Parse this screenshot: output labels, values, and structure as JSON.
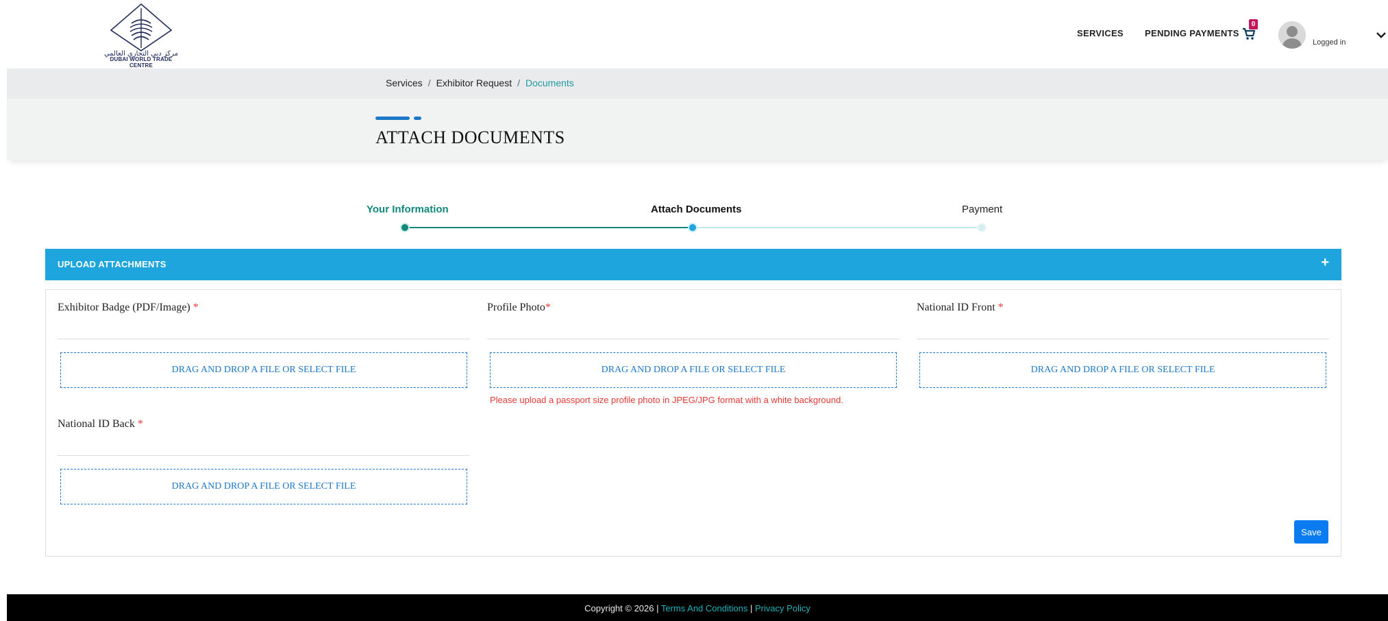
{
  "header": {
    "logo_ar": "مركز دبي التجاري العالمي",
    "logo_en": "DUBAI WORLD TRADE CENTRE",
    "nav": [
      "SERVICES",
      "PENDING PAYMENTS"
    ],
    "cart_count": "0",
    "user_status": "Logged in"
  },
  "breadcrumb": {
    "items": [
      "Services",
      "Exhibitor Request"
    ],
    "current": "Documents",
    "separator": "/"
  },
  "page_title": "ATTACH DOCUMENTS",
  "stepper": {
    "steps": [
      "Your Information",
      "Attach Documents",
      "Payment"
    ],
    "colors": {
      "done": "#11897a",
      "current": "#1ea5dd",
      "pending": "#bfe6ea"
    }
  },
  "upload": {
    "header": "UPLOAD ATTACHMENTS",
    "toggle": "+",
    "dropzone_label": "DRAG AND DROP A FILE OR SELECT FILE",
    "fields": [
      {
        "label": "Exhibitor Badge (PDF/Image)",
        "required": "*"
      },
      {
        "label": "Profile Photo",
        "required": "*",
        "note": "Please upload a passport size profile photo in JPEG/JPG format with a white background."
      },
      {
        "label": "National ID Front",
        "required": "*"
      },
      {
        "label": "National ID Back",
        "required": "*"
      }
    ],
    "save_label": "Save"
  },
  "footer": {
    "copyright": "Copyright © 2026 | ",
    "terms": "Terms And Conditions",
    "pipe": " | ",
    "privacy": "Privacy Policy"
  },
  "colors": {
    "accent": "#1ea5dd",
    "primary": "#0a7bf0",
    "teal": "#1f9aa0",
    "required": "#e53935"
  }
}
